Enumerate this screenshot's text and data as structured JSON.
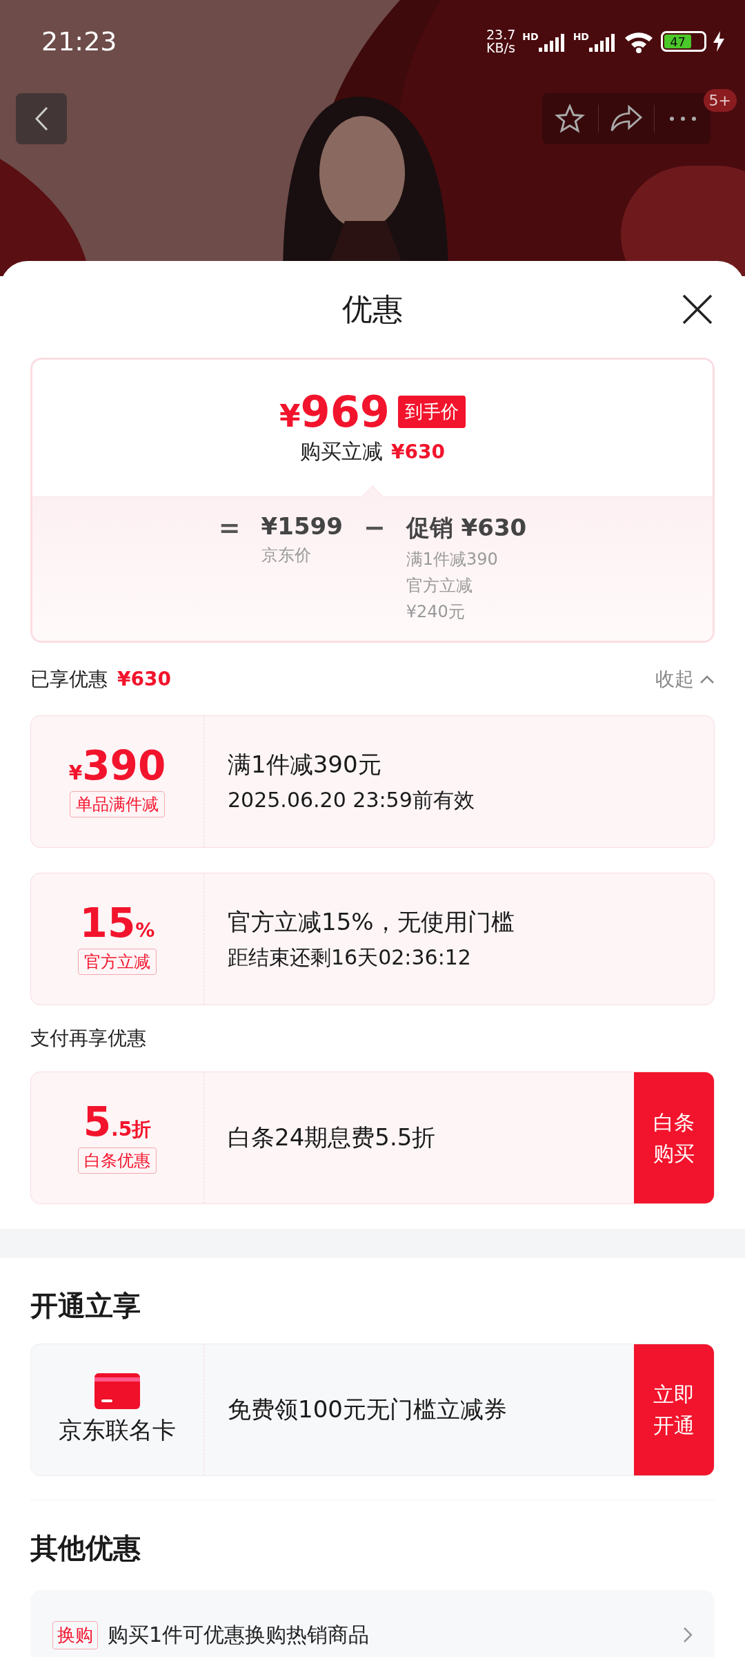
{
  "status_bar": {
    "time": "21:23",
    "speed_value": "23.7",
    "speed_unit": "KB/s",
    "signal_labels": [
      "HD",
      "HD"
    ],
    "battery": "47",
    "charging": true
  },
  "header": {
    "badge": "5+"
  },
  "sheet": {
    "title": "优惠"
  },
  "price_card": {
    "price_symbol": "¥",
    "price": "969",
    "price_tag": "到手价",
    "saving_label": "购买立减",
    "saving_value": "¥630",
    "equals": "=",
    "base_price": "¥1599",
    "base_label": "京东价",
    "minus": "−",
    "promo_label": "促销 ¥630",
    "promo_details": [
      "满1件减390",
      "官方立减",
      "¥240元"
    ]
  },
  "enjoyed": {
    "label": "已享优惠",
    "value": "¥630",
    "toggle": "收起",
    "expanded": true
  },
  "coupons": [
    {
      "prefix": "¥",
      "main": "390",
      "tag": "单品满件减",
      "title": "满1件减390元",
      "subtitle": "2025.06.20 23:59前有效"
    },
    {
      "main": "15",
      "suffix": "%",
      "tag": "官方立减",
      "title": "官方立减15%，无使用门槛",
      "subtitle": "距结束还剩16天02:36:12"
    }
  ],
  "payment": {
    "heading": "支付再享优惠",
    "offers": [
      {
        "main": "5",
        "suffix": ".5折",
        "tag": "白条优惠",
        "title": "白条24期息费5.5折",
        "action": [
          "白条",
          "购买"
        ]
      }
    ]
  },
  "open_section": {
    "heading": "开通立享",
    "offers": [
      {
        "card_name": "京东联名卡",
        "title": "免费领100元无门槛立减券",
        "action": [
          "立即",
          "开通"
        ]
      }
    ]
  },
  "other_section": {
    "heading": "其他优惠",
    "items": [
      {
        "tag": "换购",
        "text": "购买1件可优惠换购热销商品"
      }
    ]
  }
}
